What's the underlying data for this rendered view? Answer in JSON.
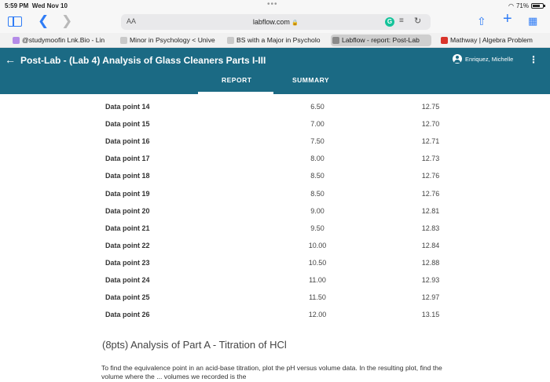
{
  "status_bar": {
    "time": "5:59 PM",
    "date": "Wed Nov 10",
    "battery": "71%",
    "battery_level": 0.71
  },
  "browser": {
    "address_aa": "AA",
    "url": "labflow.com",
    "lock_icon": "lock-icon",
    "grammarly_badge": "G",
    "bookmarks": [
      {
        "label": "@studymoofin Lnk.Bio - Lin",
        "color": "#b48be8"
      },
      {
        "label": "Minor in Psychology < Unive",
        "color": "#c9c9c9"
      },
      {
        "label": "BS with a Major in Psycholo",
        "color": "#c9c9c9"
      },
      {
        "label": "Labflow - report: Post-Lab",
        "color": "#8a8a8a"
      },
      {
        "label": "Mathway | Algebra Problem",
        "color": "#d9342b"
      }
    ]
  },
  "header": {
    "title": "Post-Lab - (Lab 4) Analysis of Glass Cleaners Parts I-III",
    "user_name": "Enriquez, Michelle",
    "tabs": [
      {
        "label": "REPORT"
      },
      {
        "label": "SUMMARY"
      }
    ]
  },
  "table": {
    "rows": [
      {
        "label": "Data point 14",
        "volume": "6.50",
        "ph": "12.75"
      },
      {
        "label": "Data point 15",
        "volume": "7.00",
        "ph": "12.70"
      },
      {
        "label": "Data point 16",
        "volume": "7.50",
        "ph": "12.71"
      },
      {
        "label": "Data point 17",
        "volume": "8.00",
        "ph": "12.73"
      },
      {
        "label": "Data point 18",
        "volume": "8.50",
        "ph": "12.76"
      },
      {
        "label": "Data point 19",
        "volume": "8.50",
        "ph": "12.76"
      },
      {
        "label": "Data point 20",
        "volume": "9.00",
        "ph": "12.81"
      },
      {
        "label": "Data point 21",
        "volume": "9.50",
        "ph": "12.83"
      },
      {
        "label": "Data point 22",
        "volume": "10.00",
        "ph": "12.84"
      },
      {
        "label": "Data point 23",
        "volume": "10.50",
        "ph": "12.88"
      },
      {
        "label": "Data point 24",
        "volume": "11.00",
        "ph": "12.93"
      },
      {
        "label": "Data point 25",
        "volume": "11.50",
        "ph": "12.97"
      },
      {
        "label": "Data point 26",
        "volume": "12.00",
        "ph": "13.15"
      }
    ]
  },
  "section": {
    "heading": "(8pts) Analysis of Part A - Titration of HCl",
    "paragraph": "To find the equivalence point in an acid-base titration, plot the pH versus volume data. In the resulting plot, find the volume where the ... volumes we recorded is the"
  },
  "colors": {
    "header_bg": "#1b6a84",
    "accent": "#2f7cf6"
  }
}
